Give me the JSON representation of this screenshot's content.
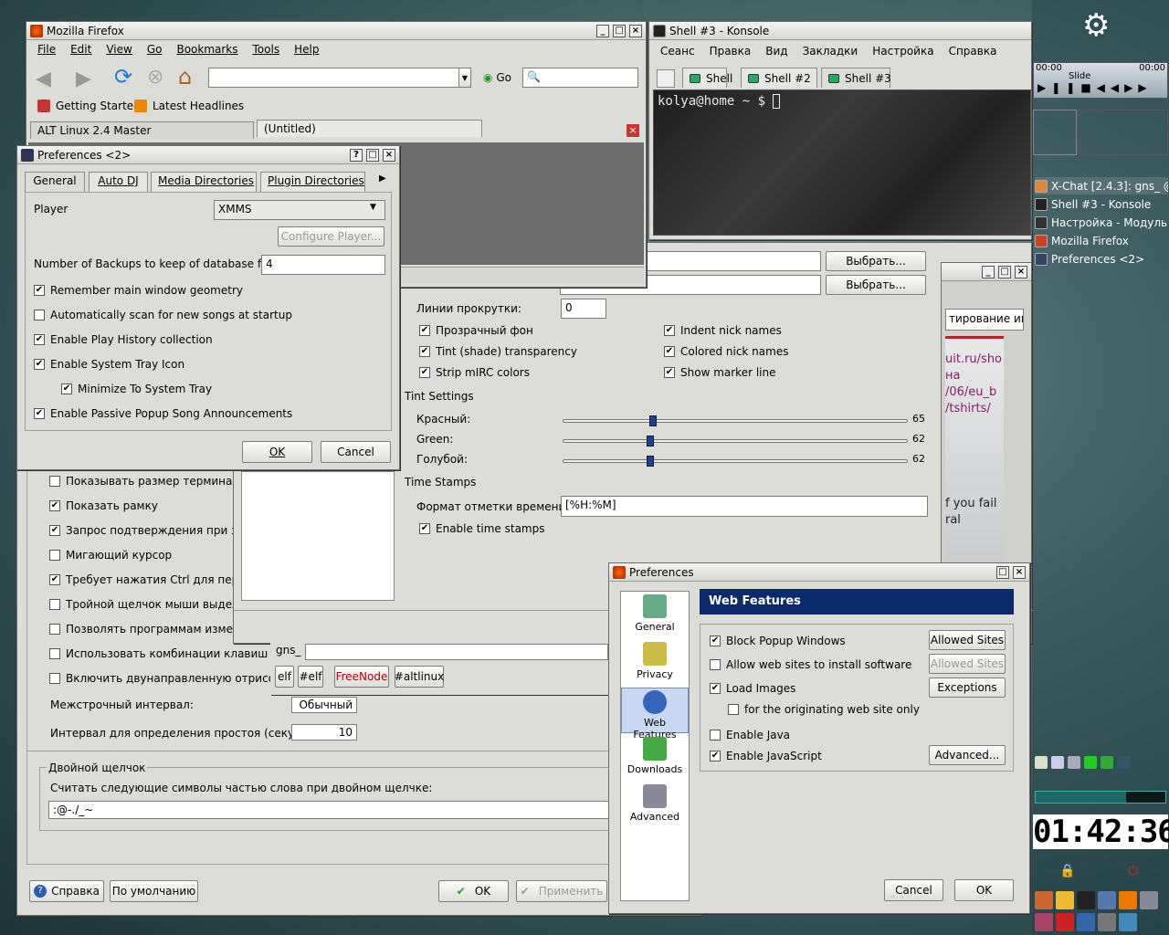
{
  "firefox": {
    "title": "Mozilla Firefox",
    "menu": [
      "File",
      "Edit",
      "View",
      "Go",
      "Bookmarks",
      "Tools",
      "Help"
    ],
    "go_label": "Go",
    "bookmarks": [
      "Getting Started",
      "Latest Headlines"
    ],
    "tabs": [
      "ALT Linux 2.4 Master",
      "(Untitled)"
    ]
  },
  "konsole": {
    "title": "Shell #3 - Konsole",
    "menu": [
      "Сеанс",
      "Правка",
      "Вид",
      "Закладки",
      "Настройка",
      "Справка"
    ],
    "tabs": [
      "Shell",
      "Shell #2",
      "Shell #3"
    ],
    "prompt": "kolya@home ~ $ "
  },
  "amarok": {
    "title": "Preferences <2>",
    "tabs": [
      "General",
      "Auto DJ",
      "Media Directories",
      "Plugin Directories"
    ],
    "player_label": "Player",
    "player_value": "XMMS",
    "configure": "Configure Player...",
    "backups_label": "Number of Backups to keep of database files",
    "backups_value": "4",
    "opts": [
      "Remember main window geometry",
      "Automatically scan for new songs at startup",
      "Enable Play History collection",
      "Enable System Tray Icon",
      "Minimize To System Tray",
      "Enable Passive Popup Song Announcements"
    ],
    "ok": "OK",
    "cancel": "Cancel"
  },
  "kcm": {
    "opts": [
      "Показывать размер терминала п",
      "Показать рамку",
      "Запрос подтверждения при закр",
      "Мигающий курсор",
      "Требует нажатия Ctrl для перета",
      "Тройной щелчок мыши выделя",
      "Позволять программам изменят",
      "Использовать комбинации клавиш Ctrl+",
      "Включить двунаправленную отрисовку"
    ],
    "line_spacing_label": "Межстрочный интервал:",
    "line_spacing_value": "Обычный",
    "idle_label": "Интервал для определения простоя (секунд):",
    "idle_value": "10",
    "dbl_group": "Двойной щелчок",
    "dbl_label": "Считать следующие символы частью слова при двойном щелчке:",
    "dbl_value": ":@-./_~",
    "help": "Справка",
    "defaults": "По умолчанию",
    "ok": "OK",
    "apply": "Применить"
  },
  "xchat": {
    "choose": "Выбрать...",
    "scroll_label": "Линии прокрутки:",
    "scroll_value": "0",
    "opts_left": [
      "Прозрачный фон",
      "Tint (shade) transparency",
      "Strip mIRC colors"
    ],
    "opts_right": [
      "Indent nick names",
      "Colored nick names",
      "Show marker line"
    ],
    "tint_header": "Tint Settings",
    "red": "Красный:",
    "green": "Green:",
    "blue": "Голубой:",
    "red_v": "65",
    "green_v": "62",
    "blue_v": "62",
    "ts_header": "Time Stamps",
    "ts_label": "Формат отметки времени:",
    "ts_value": "[%H:%M]",
    "ts_enable": "Enable time stamps",
    "nick": "gns_",
    "chan_tabs": [
      "elf",
      "#elf",
      "FreeNode",
      "#altlinux"
    ],
    "chat_text": [
      "uit.ru/sho",
      "на",
      "/06/eu_b",
      "/tshirts/",
      "f you fail",
      "ral"
    ],
    "side_title": "тирование ин"
  },
  "ffprefs": {
    "title": "Preferences",
    "header": "Web Features",
    "cats": [
      "General",
      "Privacy",
      "Web Features",
      "Downloads",
      "Advanced"
    ],
    "opts": [
      "Block Popup Windows",
      "Allow web sites to install software",
      "Load Images",
      "for the originating web site only",
      "Enable Java",
      "Enable JavaScript"
    ],
    "allowed": "Allowed Sites",
    "exceptions": "Exceptions",
    "advanced": "Advanced...",
    "cancel": "Cancel",
    "ok": "OK"
  },
  "panel": {
    "clock": "01:42:36",
    "time_l": "00:00",
    "time_r": "00:00",
    "slide": "Slide",
    "tasks": [
      "X-Chat [2.4.3]: gns_ @",
      "Shell #3 - Konsole",
      "Настройка - Модуль н",
      "Mozilla Firefox",
      "Preferences <2>"
    ]
  }
}
